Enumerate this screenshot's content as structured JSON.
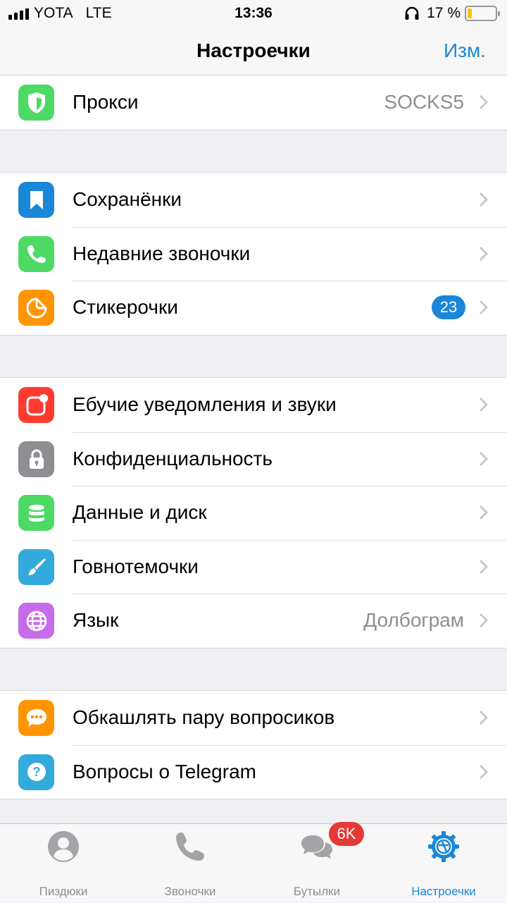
{
  "status_bar": {
    "carrier": "YOTA",
    "network": "LTE",
    "time": "13:36",
    "battery_text": "17 %",
    "battery_level": 0.17
  },
  "nav": {
    "title": "Настроечки",
    "edit_label": "Изм."
  },
  "sections": [
    [
      {
        "label": "Прокси",
        "value": "SOCKS5",
        "icon": "shield-icon",
        "color": "#4cd964"
      }
    ],
    [
      {
        "label": "Сохранёнки",
        "icon": "bookmark-icon",
        "color": "#1a87d8"
      },
      {
        "label": "Недавние звоночки",
        "icon": "phone-icon",
        "color": "#4cd964"
      },
      {
        "label": "Стикерочки",
        "badge": "23",
        "icon": "sticker-icon",
        "color": "#ff9500"
      }
    ],
    [
      {
        "label": "Ебучие уведомления и звуки",
        "icon": "notification-icon",
        "color": "#ff3b30"
      },
      {
        "label": "Конфиденциальность",
        "icon": "lock-icon",
        "color": "#8e8e93"
      },
      {
        "label": "Данные и диск",
        "icon": "database-icon",
        "color": "#4cd964"
      },
      {
        "label": "Говнотемочки",
        "icon": "brush-icon",
        "color": "#34aadc"
      },
      {
        "label": "Язык",
        "value": "Долбограм",
        "icon": "globe-icon",
        "color": "#c86bea"
      }
    ],
    [
      {
        "label": "Обкашлять пару вопросиков",
        "icon": "chat-bubble-icon",
        "color": "#ff9500"
      },
      {
        "label": "Вопросы о Telegram",
        "icon": "question-icon",
        "color": "#34aadc"
      }
    ]
  ],
  "tabs": [
    {
      "label": "Пиздюки",
      "icon": "contacts-icon",
      "active": false
    },
    {
      "label": "Звоночки",
      "icon": "calls-icon",
      "active": false
    },
    {
      "label": "Бутылки",
      "icon": "chats-icon",
      "active": false,
      "badge": "6K"
    },
    {
      "label": "Настроечки",
      "icon": "settings-icon",
      "active": true
    }
  ],
  "colors": {
    "accent": "#1a87d8",
    "badge_red": "#e53935",
    "background": "#efeff4"
  }
}
